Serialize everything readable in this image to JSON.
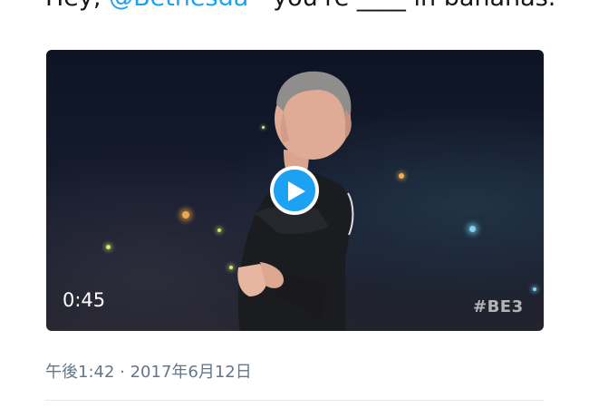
{
  "tweet": {
    "text_before": "Hey, ",
    "mention": "@Bethesda",
    "text_after": " - you're ",
    "censored": "____",
    "text_end": " in bananas."
  },
  "video": {
    "duration": "0:45",
    "watermark": "#BE3",
    "play_icon": "play-icon"
  },
  "meta": {
    "timestamp": "午後1:42 · 2017年6月12日"
  },
  "colors": {
    "accent": "#1da1f2",
    "text": "#14171a",
    "muted": "#657786"
  }
}
